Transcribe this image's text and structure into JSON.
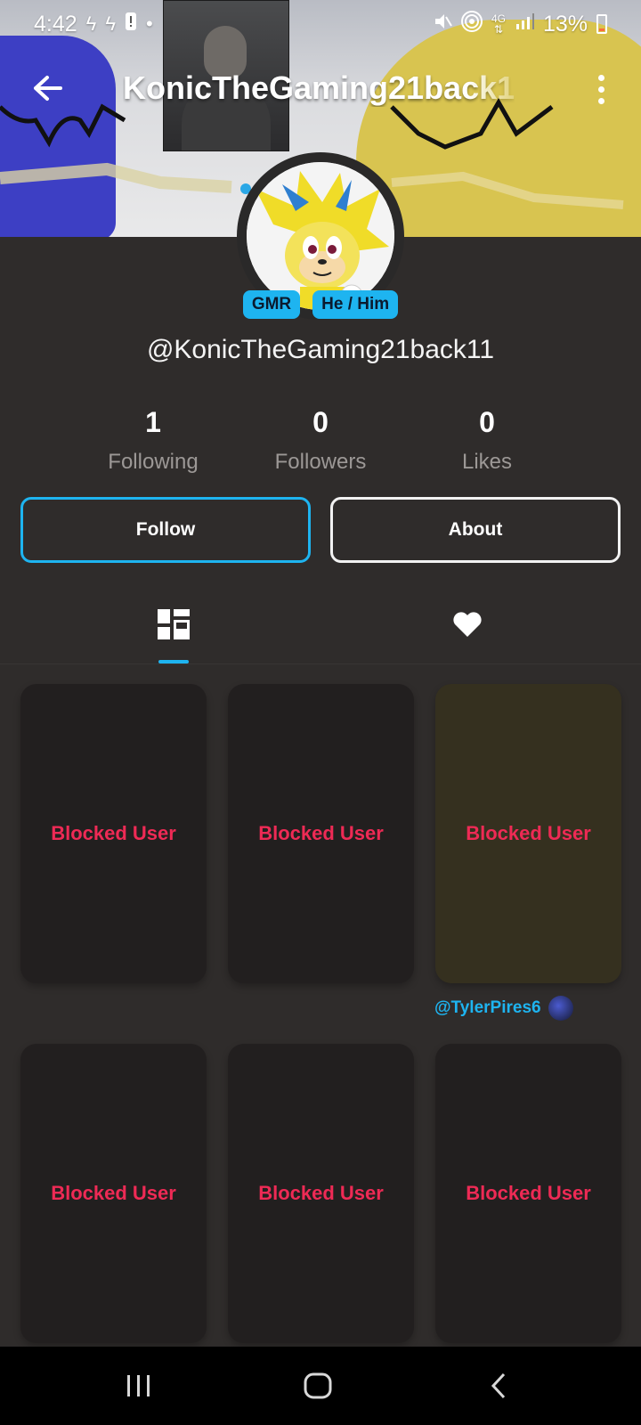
{
  "status_bar": {
    "time": "4:42",
    "left_icons": [
      "flash-icon",
      "flash-icon",
      "alert-icon",
      "dot-icon"
    ],
    "network": "4G",
    "battery": "13%",
    "right_icons": [
      "mute-icon",
      "hotspot-icon",
      "network-arrows-icon",
      "signal-icon",
      "battery-icon"
    ]
  },
  "header": {
    "title": "KonicTheGaming21back1",
    "back_icon": "arrow-left-icon",
    "more_icon": "more-vertical-icon"
  },
  "profile": {
    "badges": [
      "GMR",
      "He / Him"
    ],
    "handle": "@KonicTheGaming21back11",
    "stats": [
      {
        "value": "1",
        "label": "Following"
      },
      {
        "value": "0",
        "label": "Followers"
      },
      {
        "value": "0",
        "label": "Likes"
      }
    ],
    "follow_label": "Follow",
    "about_label": "About"
  },
  "tabs": [
    {
      "icon": "posts-grid-icon",
      "active": true
    },
    {
      "icon": "heart-icon",
      "active": false
    }
  ],
  "posts": [
    {
      "label": "Blocked User"
    },
    {
      "label": "Blocked User"
    },
    {
      "label": "Blocked User",
      "tagged_user": "@TylerPires6"
    },
    {
      "label": "Blocked User"
    },
    {
      "label": "Blocked User"
    },
    {
      "label": "Blocked User"
    }
  ],
  "nav_bar": {
    "icons": [
      "recents-icon",
      "home-icon",
      "back-icon"
    ]
  },
  "colors": {
    "accent": "#1eb4f0",
    "background": "#2f2c2b",
    "card": "#221f1f",
    "blocked_text": "#ee2a55"
  }
}
